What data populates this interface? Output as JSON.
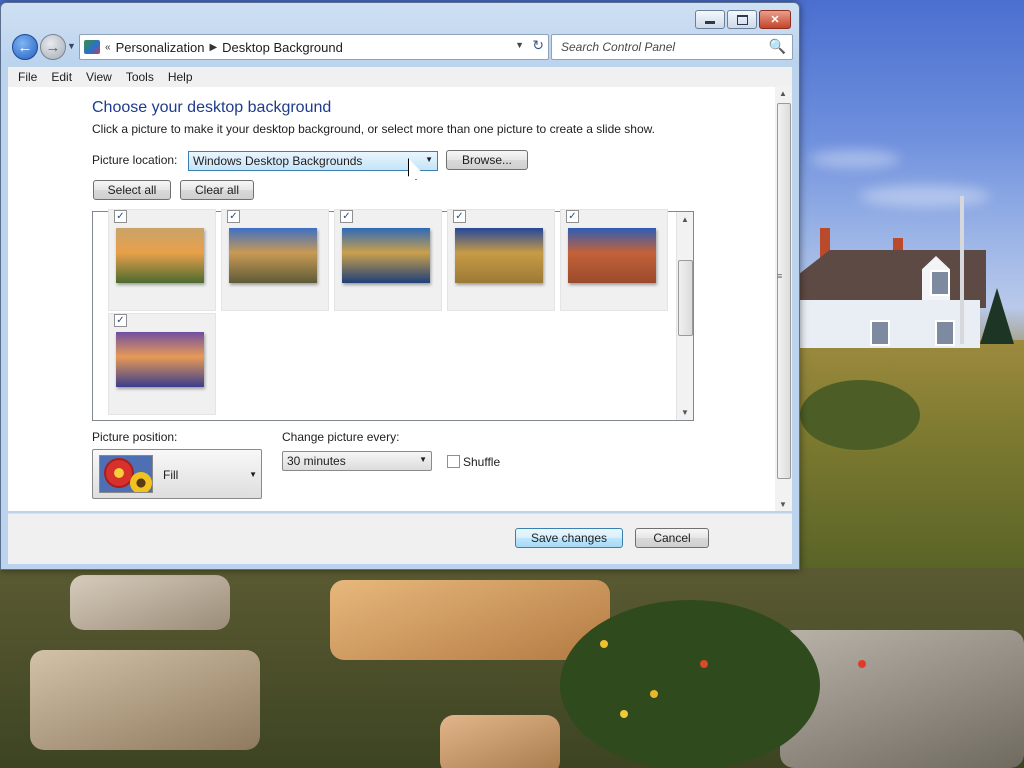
{
  "window": {
    "breadcrumb": {
      "root": "Personalization",
      "current": "Desktop Background"
    },
    "search": {
      "placeholder": "Search Control Panel"
    },
    "caption_buttons": {
      "minimize": "▭",
      "maximize": "□",
      "close": "✕"
    }
  },
  "menu": [
    "File",
    "Edit",
    "View",
    "Tools",
    "Help"
  ],
  "content": {
    "title": "Choose your desktop background",
    "description": "Click a picture to make it your desktop background, or select more than one picture to create a slide show.",
    "location_label": "Picture location:",
    "location_value": "Windows Desktop Backgrounds",
    "browse_label": "Browse...",
    "select_all_label": "Select all",
    "clear_all_label": "Clear all",
    "pictures": [
      {
        "name": "sunset-meadow",
        "checked": true,
        "colors": [
          "#caa36a",
          "#e8a04a",
          "#4c6b2f"
        ]
      },
      {
        "name": "lighthouse-coast",
        "checked": true,
        "colors": [
          "#3e6fc4",
          "#c89a54",
          "#5e5b38"
        ]
      },
      {
        "name": "rock-reflection",
        "checked": true,
        "colors": [
          "#2e6ab8",
          "#caa04c",
          "#1e3f78"
        ]
      },
      {
        "name": "hay-bale",
        "checked": true,
        "colors": [
          "#25489a",
          "#c79b46",
          "#9c7a34"
        ]
      },
      {
        "name": "delicate-arch",
        "checked": true,
        "colors": [
          "#2f5cb5",
          "#c4623a",
          "#9a4a2c"
        ]
      },
      {
        "name": "lake-flowers",
        "checked": true,
        "colors": [
          "#6f4fa0",
          "#e89a56",
          "#3b3d8c"
        ]
      }
    ],
    "position_label": "Picture position:",
    "position_value": "Fill",
    "interval_label": "Change picture every:",
    "interval_value": "30 minutes",
    "shuffle_label": "Shuffle",
    "shuffle_checked": false
  },
  "footer": {
    "save_label": "Save changes",
    "cancel_label": "Cancel"
  }
}
